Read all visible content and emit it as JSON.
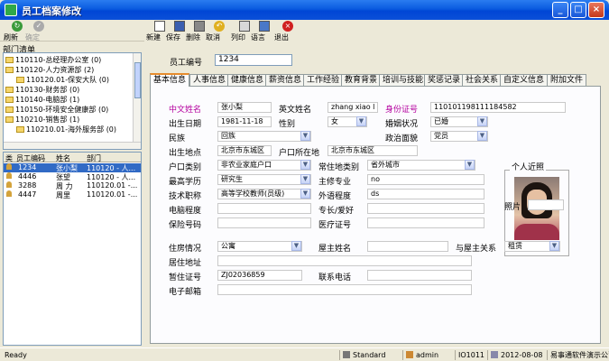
{
  "window": {
    "title": "员工档案修改"
  },
  "left_toolbar": {
    "refresh": "刷新",
    "confirm": "确定"
  },
  "toolbar": {
    "new": "新建",
    "save": "保存",
    "delete": "删除",
    "cancel": "取消",
    "print": "列印",
    "language": "语言",
    "exit": "退出"
  },
  "departments": {
    "title": "部门清单",
    "items": [
      "110110-总经理办公室 (0)",
      "110120-人力资源部 (2)",
      "110120.01-保安大队 (0)",
      "110130-财务部 (0)",
      "110140-电脑部 (1)",
      "110150-环境安全健康部 (0)",
      "110210-销售部 (1)",
      "110210.01-海外服务部 (0)"
    ]
  },
  "employees": {
    "headers": [
      "类",
      "员工编码",
      "姓名",
      "部门"
    ],
    "rows": [
      {
        "code": "1234",
        "name": "张小梨",
        "dept": "110120 - 人..."
      },
      {
        "code": "4446",
        "name": "张望",
        "dept": "110120 - 人..."
      },
      {
        "code": "3288",
        "name": "周 力",
        "dept": "110120.01 -..."
      },
      {
        "code": "4447",
        "name": "周里",
        "dept": "110120.01 -..."
      }
    ]
  },
  "form": {
    "emp_no_label": "员工编号",
    "emp_no": "1234",
    "tabs": [
      "基本信息",
      "人事信息",
      "健康信息",
      "薪资信息",
      "工作经验",
      "教育背景",
      "培训与技能",
      "奖惩记录",
      "社会关系",
      "自定义信息",
      "附加文件"
    ],
    "chinese_name_label": "中文姓名",
    "chinese_name": "张小梨",
    "english_name_label": "英文姓名",
    "english_name": "zhang xiao l",
    "id_label": "身份证号",
    "id_no": "110101198111184582",
    "birth_label": "出生日期",
    "birth": "1981-11-18",
    "gender_label": "性别",
    "gender": "女",
    "marital_label": "婚姻状况",
    "marital": "已婚",
    "nation_label": "民族",
    "nation": "回族",
    "political_label": "政治面貌",
    "political": "党员",
    "birthplace_label": "出生地点",
    "birthplace": "北京市东城区",
    "household_label": "户口所在地",
    "household": "北京市东城区",
    "hukou_type_label": "户口类别",
    "hukou_type": "非农业家庭户口",
    "residence_label": "常住地类别",
    "residence": "省外城市",
    "education_label": "最高学历",
    "education": "研究生",
    "major_label": "主修专业",
    "major": "no",
    "title_label": "技术职称",
    "title_value": "高等学校教师(员级)",
    "language_label": "外语程度",
    "language": "ds",
    "computer_label": "电脑程度",
    "computer": "",
    "hobby_label": "专长/爱好",
    "hobby": "",
    "insurance_label": "保险号码",
    "insurance": "",
    "medical_label": "医疗证号",
    "medical": "",
    "photo_title": "个人近照",
    "photo_label": "照片",
    "housing_label": "住房情况",
    "housing": "公寓",
    "owner_label": "屋主姓名",
    "owner": "",
    "relation_label": "与屋主关系",
    "relation": "租赁",
    "address_label": "居住地址",
    "address": "",
    "permit_label": "暂住证号",
    "permit": "ZJ02036859",
    "phone_label": "联系电话",
    "phone": "",
    "email_label": "电子邮箱",
    "email": ""
  },
  "statusbar": {
    "ready": "Ready",
    "mode": "Standard",
    "user": "admin",
    "code": "IO1011",
    "date": "2012-08-08",
    "company": "易事通软件演示公司"
  }
}
